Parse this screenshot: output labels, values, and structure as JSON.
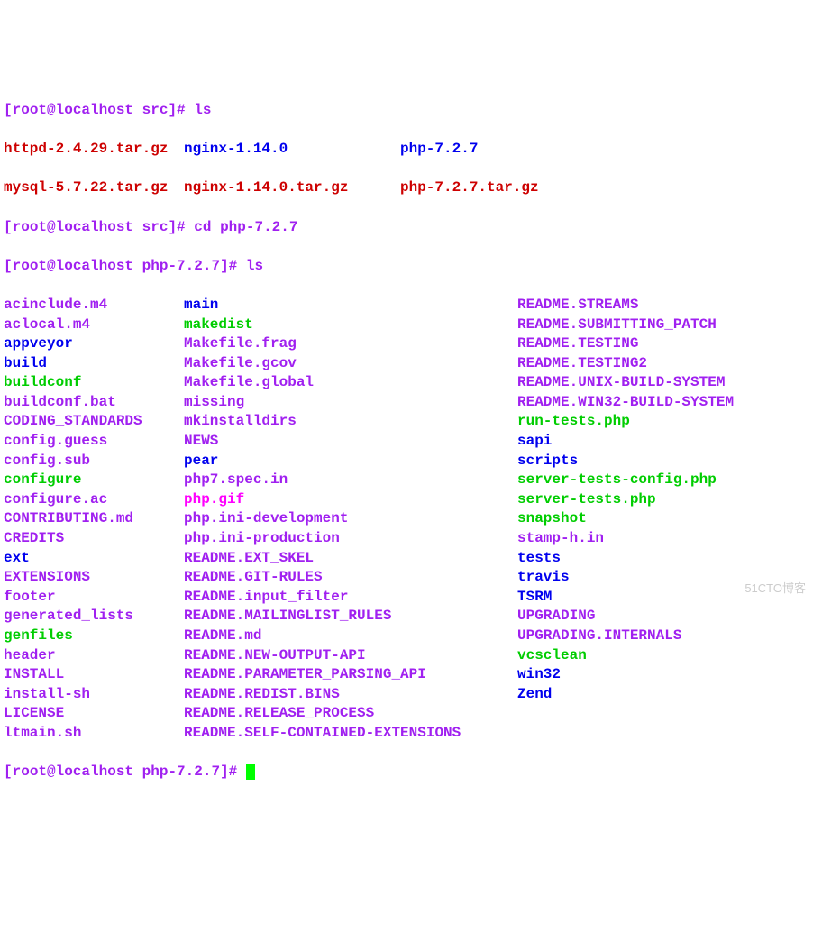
{
  "prompt1": {
    "open": "[",
    "user": "root@localhost",
    "dir": "src",
    "close": "]# ",
    "cmd": "ls"
  },
  "row1": {
    "a": "httpd-2.4.29.tar.gz",
    "b": "nginx-1.14.0",
    "c": "php-7.2.7"
  },
  "row2": {
    "a": "mysql-5.7.22.tar.gz",
    "b": "nginx-1.14.0.tar.gz",
    "c": "php-7.2.7.tar.gz"
  },
  "prompt2": {
    "open": "[",
    "user": "root@localhost",
    "dir": "src",
    "close": "]# ",
    "cmd": "cd php-7.2.7"
  },
  "prompt3": {
    "open": "[",
    "user": "root@localhost",
    "dir": "php-7.2.7",
    "close": "]# ",
    "cmd": "ls"
  },
  "listing": [
    {
      "a": {
        "t": "acinclude.m4",
        "c": "purple"
      },
      "b": {
        "t": "main",
        "c": "blue"
      },
      "c": {
        "t": "README.STREAMS",
        "c": "purple"
      }
    },
    {
      "a": {
        "t": "aclocal.m4",
        "c": "purple"
      },
      "b": {
        "t": "makedist",
        "c": "green"
      },
      "c": {
        "t": "README.SUBMITTING_PATCH",
        "c": "purple"
      }
    },
    {
      "a": {
        "t": "appveyor",
        "c": "blue"
      },
      "b": {
        "t": "Makefile.frag",
        "c": "purple"
      },
      "c": {
        "t": "README.TESTING",
        "c": "purple"
      }
    },
    {
      "a": {
        "t": "build",
        "c": "blue"
      },
      "b": {
        "t": "Makefile.gcov",
        "c": "purple"
      },
      "c": {
        "t": "README.TESTING2",
        "c": "purple"
      }
    },
    {
      "a": {
        "t": "buildconf",
        "c": "green"
      },
      "b": {
        "t": "Makefile.global",
        "c": "purple"
      },
      "c": {
        "t": "README.UNIX-BUILD-SYSTEM",
        "c": "purple"
      }
    },
    {
      "a": {
        "t": "buildconf.bat",
        "c": "purple"
      },
      "b": {
        "t": "missing",
        "c": "purple"
      },
      "c": {
        "t": "README.WIN32-BUILD-SYSTEM",
        "c": "purple"
      }
    },
    {
      "a": {
        "t": "CODING_STANDARDS",
        "c": "purple"
      },
      "b": {
        "t": "mkinstalldirs",
        "c": "purple"
      },
      "c": {
        "t": "run-tests.php",
        "c": "green"
      }
    },
    {
      "a": {
        "t": "config.guess",
        "c": "purple"
      },
      "b": {
        "t": "NEWS",
        "c": "purple"
      },
      "c": {
        "t": "sapi",
        "c": "blue"
      }
    },
    {
      "a": {
        "t": "config.sub",
        "c": "purple"
      },
      "b": {
        "t": "pear",
        "c": "blue"
      },
      "c": {
        "t": "scripts",
        "c": "blue"
      }
    },
    {
      "a": {
        "t": "configure",
        "c": "green"
      },
      "b": {
        "t": "php7.spec.in",
        "c": "purple"
      },
      "c": {
        "t": "server-tests-config.php",
        "c": "green"
      }
    },
    {
      "a": {
        "t": "configure.ac",
        "c": "purple"
      },
      "b": {
        "t": "php.gif",
        "c": "magenta"
      },
      "c": {
        "t": "server-tests.php",
        "c": "green"
      }
    },
    {
      "a": {
        "t": "CONTRIBUTING.md",
        "c": "purple"
      },
      "b": {
        "t": "php.ini-development",
        "c": "purple"
      },
      "c": {
        "t": "snapshot",
        "c": "green"
      }
    },
    {
      "a": {
        "t": "CREDITS",
        "c": "purple"
      },
      "b": {
        "t": "php.ini-production",
        "c": "purple"
      },
      "c": {
        "t": "stamp-h.in",
        "c": "purple"
      }
    },
    {
      "a": {
        "t": "ext",
        "c": "blue"
      },
      "b": {
        "t": "README.EXT_SKEL",
        "c": "purple"
      },
      "c": {
        "t": "tests",
        "c": "blue"
      }
    },
    {
      "a": {
        "t": "EXTENSIONS",
        "c": "purple"
      },
      "b": {
        "t": "README.GIT-RULES",
        "c": "purple"
      },
      "c": {
        "t": "travis",
        "c": "blue"
      }
    },
    {
      "a": {
        "t": "footer",
        "c": "purple"
      },
      "b": {
        "t": "README.input_filter",
        "c": "purple"
      },
      "c": {
        "t": "TSRM",
        "c": "blue"
      }
    },
    {
      "a": {
        "t": "generated_lists",
        "c": "purple"
      },
      "b": {
        "t": "README.MAILINGLIST_RULES",
        "c": "purple"
      },
      "c": {
        "t": "UPGRADING",
        "c": "purple"
      }
    },
    {
      "a": {
        "t": "genfiles",
        "c": "green"
      },
      "b": {
        "t": "README.md",
        "c": "purple"
      },
      "c": {
        "t": "UPGRADING.INTERNALS",
        "c": "purple"
      }
    },
    {
      "a": {
        "t": "header",
        "c": "purple"
      },
      "b": {
        "t": "README.NEW-OUTPUT-API",
        "c": "purple"
      },
      "c": {
        "t": "vcsclean",
        "c": "green"
      }
    },
    {
      "a": {
        "t": "INSTALL",
        "c": "purple"
      },
      "b": {
        "t": "README.PARAMETER_PARSING_API",
        "c": "purple"
      },
      "c": {
        "t": "win32",
        "c": "blue"
      }
    },
    {
      "a": {
        "t": "install-sh",
        "c": "purple"
      },
      "b": {
        "t": "README.REDIST.BINS",
        "c": "purple"
      },
      "c": {
        "t": "Zend",
        "c": "blue"
      }
    },
    {
      "a": {
        "t": "LICENSE",
        "c": "purple"
      },
      "b": {
        "t": "README.RELEASE_PROCESS",
        "c": "purple"
      },
      "c": {
        "t": "",
        "c": ""
      }
    },
    {
      "a": {
        "t": "ltmain.sh",
        "c": "purple"
      },
      "b": {
        "t": "README.SELF-CONTAINED-EXTENSIONS",
        "c": "purple"
      },
      "c": {
        "t": "",
        "c": ""
      }
    }
  ],
  "prompt4": {
    "open": "[",
    "user": "root@localhost",
    "dir": "php-7.2.7",
    "close": "]# "
  },
  "watermark": "51CTO博客"
}
